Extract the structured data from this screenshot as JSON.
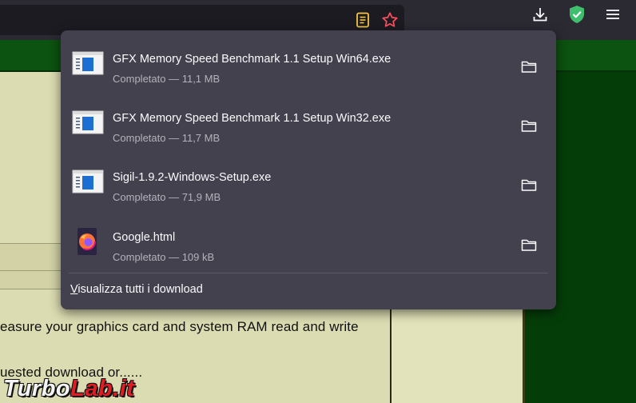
{
  "toolbar": {
    "reader_icon": "reader-view-icon",
    "bookmark_icon": "bookmark-star-icon",
    "downloads_icon": "downloads-arrow-icon",
    "shield_icon": "shield-check-icon",
    "menu_icon": "hamburger-menu-icon",
    "colors": {
      "reader": "#f5c542",
      "bookmark": "#ff4f5e",
      "shield": "#3fbf6e"
    }
  },
  "downloads_panel": {
    "items": [
      {
        "name": "GFX Memory Speed Benchmark 1.1 Setup Win64.exe",
        "status": "Completato — 11,1 MB",
        "icon": "exe-file-icon"
      },
      {
        "name": "GFX Memory Speed Benchmark 1.1 Setup Win32.exe",
        "status": "Completato — 11,7 MB",
        "icon": "exe-file-icon"
      },
      {
        "name": "Sigil-1.9.2-Windows-Setup.exe",
        "status": "Completato — 71,9 MB",
        "icon": "exe-file-icon"
      },
      {
        "name": "Google.html",
        "status": "Completato — 109 kB",
        "icon": "firefox-html-file-icon"
      }
    ],
    "show_all_first": "V",
    "show_all_rest": "isualizza tutti i download",
    "folder_icon": "folder-icon"
  },
  "page": {
    "line1": "easure your graphics card and system RAM read and write",
    "line2": "uested download or......",
    "watermark_a": "Turbo",
    "watermark_b": "Lab.it"
  }
}
